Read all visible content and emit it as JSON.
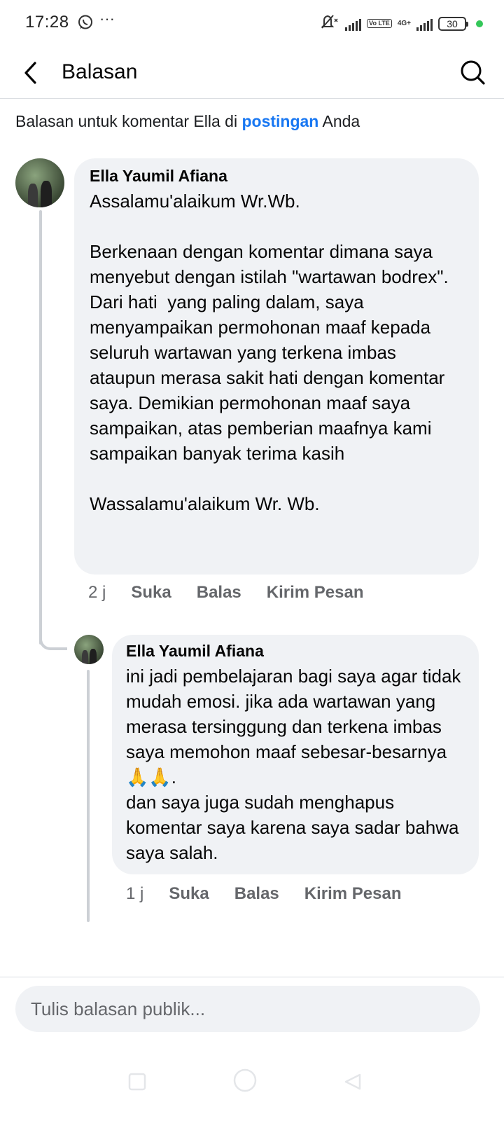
{
  "status_bar": {
    "time": "17:28",
    "battery": "30",
    "network": "4G+",
    "volte": "Vo LTE"
  },
  "header": {
    "title": "Balasan"
  },
  "context": {
    "prefix": "Balasan untuk komentar Ella di ",
    "link": "postingan",
    "suffix": " Anda"
  },
  "comments": [
    {
      "author": "Ella Yaumil Afiana",
      "text": "Assalamu'alaikum Wr.Wb.\n\nBerkenaan dengan komentar dimana saya menyebut dengan istilah \"wartawan bodrex\".\nDari hati  yang paling dalam, saya menyampaikan permohonan maaf kepada seluruh wartawan yang terkena imbas ataupun merasa sakit hati dengan komentar saya. Demikian permohonan maaf saya sampaikan, atas pemberian maafnya kami sampaikan banyak terima kasih\n\nWassalamu'alaikum Wr. Wb.",
      "time": "2 j",
      "like": "Suka",
      "reply": "Balas",
      "message": "Kirim Pesan"
    },
    {
      "author": "Ella Yaumil Afiana",
      "text": "ini jadi pembelajaran bagi saya agar tidak mudah emosi. jika ada wartawan yang merasa tersinggung dan terkena imbas saya memohon maaf sebesar-besarnya🙏🙏.\ndan saya juga sudah menghapus komentar saya karena saya sadar bahwa saya salah.",
      "time": "1 j",
      "like": "Suka",
      "reply": "Balas",
      "message": "Kirim Pesan"
    }
  ],
  "composer": {
    "placeholder": "Tulis balasan publik..."
  },
  "colors": {
    "link": "#1877f2",
    "bubble": "#f0f2f5",
    "secondary_text": "#65676b"
  }
}
